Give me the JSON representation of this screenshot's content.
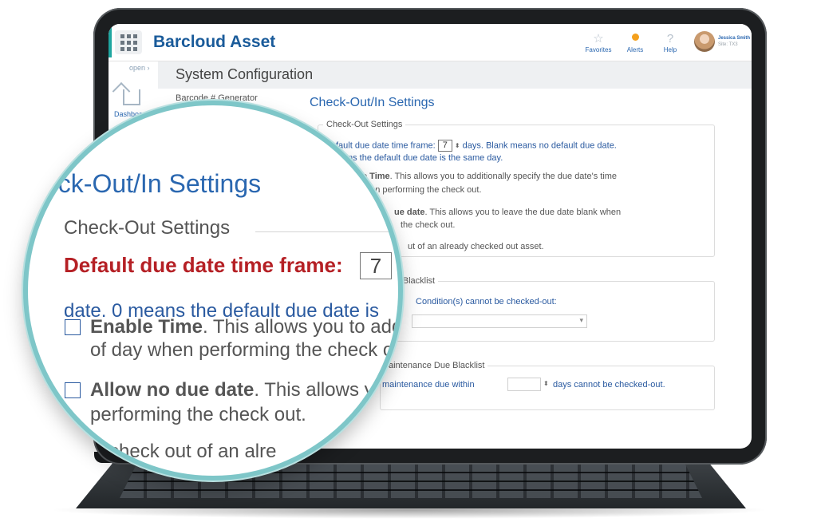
{
  "app": {
    "brand": "Barcloud Asset",
    "favorites_label": "Favorites",
    "alerts_label": "Alerts",
    "help_label": "Help",
    "user_name": "Jessica Smith",
    "user_site": "Site: TX3",
    "accent_color": "#1fa6a0",
    "brand_color": "#1a5b9a"
  },
  "rail": {
    "open_label": "open ›",
    "dashboard_label": "Dashboard"
  },
  "page": {
    "title": "System Configuration",
    "menu_item": "Barcode # Generator",
    "section_title": "Check-Out/In Settings"
  },
  "checkout": {
    "legend": "Check-Out Settings",
    "due_prefix": "Default due date time frame:",
    "due_prefix_cropped": "fault due date time frame:",
    "due_value": "7",
    "due_suffix": "days. Blank means no default due date.",
    "due_note_cropped": "ns the default due date is the same day.",
    "enable_time_bold_cropped": "e Time",
    "enable_time_rest": ". This allows you to additionally specify the due date's time",
    "enable_time_line2_cropped": "hen performing the check out.",
    "allow_no_due_bold_cropped": "ue date",
    "allow_no_due_rest": ". This allows you to leave the due date blank when",
    "allow_no_due_line2_cropped": "the check out.",
    "checked_out_line_cropped": "ut of an already checked out asset."
  },
  "condition_blacklist": {
    "legend_cropped": "ion Blacklist",
    "text_cropped": "Condition(s) cannot be checked-out:"
  },
  "maintenance_blacklist": {
    "legend_cropped": "aintenance Due Blacklist",
    "text_cropped": "maintenance due within",
    "suffix": "days cannot be checked-out."
  },
  "magnifier": {
    "title": "eck-Out/In Settings",
    "legend": "Check-Out Settings",
    "due_label": "Default due date time frame:",
    "due_value": "7",
    "date_line": "date.    0 means the default due date is",
    "enable_bold": "Enable Time",
    "enable_rest": ". This allows you to add",
    "enable_line2": "of day when performing the check o",
    "allow_bold": "Allow no due date",
    "allow_rest": ". This allows y",
    "allow_line2": "performing the check out.",
    "last_line": "w check out of an alre"
  }
}
